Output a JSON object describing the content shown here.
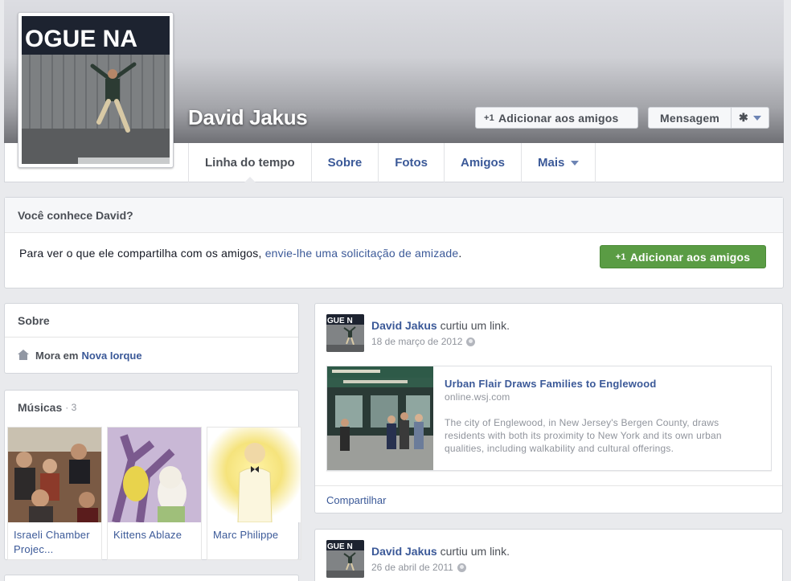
{
  "profile": {
    "name": "David Jakus",
    "photo_icon": "profile-photo"
  },
  "header": {
    "add_friend_label": "Adicionar aos amigos",
    "add_friend_prefix": "+1",
    "message_label": "Mensagem",
    "settings_icon": "gear-icon"
  },
  "tabs": [
    {
      "label": "Linha do tempo",
      "active": true
    },
    {
      "label": "Sobre"
    },
    {
      "label": "Fotos"
    },
    {
      "label": "Amigos"
    },
    {
      "label": "Mais"
    }
  ],
  "know_box": {
    "heading": "Você conhece David?",
    "text_before": "Para ver o que ele compartilha com os amigos, ",
    "link_text": "envie-lhe uma solicitação de amizade",
    "text_after": ".",
    "button_prefix": "+1",
    "button_label": "Adicionar aos amigos",
    "button_color": "#5a9c44"
  },
  "about": {
    "heading": "Sobre",
    "lives_prefix": "Mora em",
    "city": "Nova Iorque"
  },
  "music": {
    "heading": "Músicas",
    "count": "· 3",
    "items": [
      {
        "label": "Israeli Chamber Projec..."
      },
      {
        "label": "Kittens Ablaze"
      },
      {
        "label": "Marc Philippe"
      }
    ]
  },
  "posts": [
    {
      "actor": "David Jakus",
      "action": "curtiu um link.",
      "date": "18 de março de 2012",
      "link": {
        "title": "Urban Flair Draws Families to Englewood",
        "domain": "online.wsj.com",
        "description": "The city of Englewood, in New Jersey's Bergen County, draws residents with both its proximity to New York and its own urban qualities, including walkability and cultural offerings."
      },
      "share_label": "Compartilhar"
    },
    {
      "actor": "David Jakus",
      "action": "curtiu um link.",
      "date": "26 de abril de 2011"
    }
  ],
  "colors": {
    "link_blue": "#3b5998",
    "page_bg": "#e9eaed"
  }
}
